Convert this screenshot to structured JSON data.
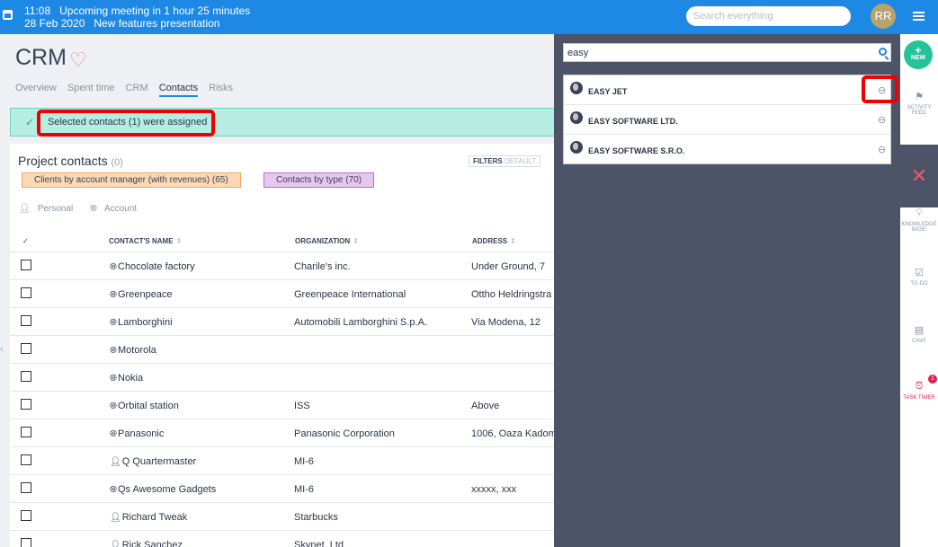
{
  "topbar": {
    "time": "11:08",
    "meeting": "Upcoming meeting in 1 hour 25 minutes",
    "date": "28 Feb 2020",
    "event": "New features presentation",
    "search_placeholder": "Search everything",
    "avatar_initials": "RR",
    "color": "#1e88e5"
  },
  "page": {
    "title": "CRM",
    "tabs": [
      "Overview",
      "Spent time",
      "CRM",
      "Contacts",
      "Risks"
    ],
    "active_tab": "Contacts",
    "flash": "Selected contacts (1) were assigned"
  },
  "panel": {
    "title": "Project contacts",
    "count": "(0)",
    "filters_label": "FILTERS",
    "filters_default": "DEFAULT",
    "tag_orange": "Clients by account manager (with revenues) (65)",
    "tag_purple": "Contacts by type (70)",
    "subfilters": [
      "Personal",
      "Account"
    ],
    "columns": [
      "CONTACT'S NAME",
      "ORGANIZATION",
      "ADDRESS"
    ],
    "rows": [
      {
        "type": "account",
        "name": "Chocolate factory",
        "org": "Charile's inc.",
        "addr": "Under Ground, 7"
      },
      {
        "type": "account",
        "name": "Greenpeace",
        "org": "Greenpeace International",
        "addr": "Ottho Heldringstra"
      },
      {
        "type": "account",
        "name": "Lamborghini",
        "org": "Automobili Lamborghini S.p.A.",
        "addr": "Via Modena, 12"
      },
      {
        "type": "account",
        "name": "Motorola",
        "org": "",
        "addr": ""
      },
      {
        "type": "account",
        "name": "Nokia",
        "org": "",
        "addr": ""
      },
      {
        "type": "account",
        "name": "Orbital station",
        "org": "ISS",
        "addr": "Above"
      },
      {
        "type": "account",
        "name": "Panasonic",
        "org": "Panasonic Corporation",
        "addr": "1006, Oaza Kadom"
      },
      {
        "type": "personal",
        "name": "Q Quartermaster",
        "org": "MI-6",
        "addr": ""
      },
      {
        "type": "account",
        "name": "Qs Awesome Gadgets",
        "org": "MI-6",
        "addr": "xxxxx, xxx"
      },
      {
        "type": "personal",
        "name": "Richard Tweak",
        "org": "Starbucks",
        "addr": ""
      },
      {
        "type": "personal",
        "name": "Rick Sanchez",
        "org": "Skynet, Ltd",
        "addr": ""
      }
    ]
  },
  "overlay": {
    "search_value": "easy",
    "results": [
      "EASY JET",
      "EASY SOFTWARE LTD.",
      "EASY SOFTWARE S.R.O."
    ]
  },
  "rail": {
    "new_label": "NEW",
    "activity_feed": "ACTIVITY FEED",
    "knowledge_base": "KNOWLEDGE BASE",
    "todo": "TO-DO",
    "chat": "CHAT",
    "task_timer": "TASK TIMER",
    "timer_badge": "1",
    "accent": "#26c39a",
    "alert": "#e0204b"
  }
}
